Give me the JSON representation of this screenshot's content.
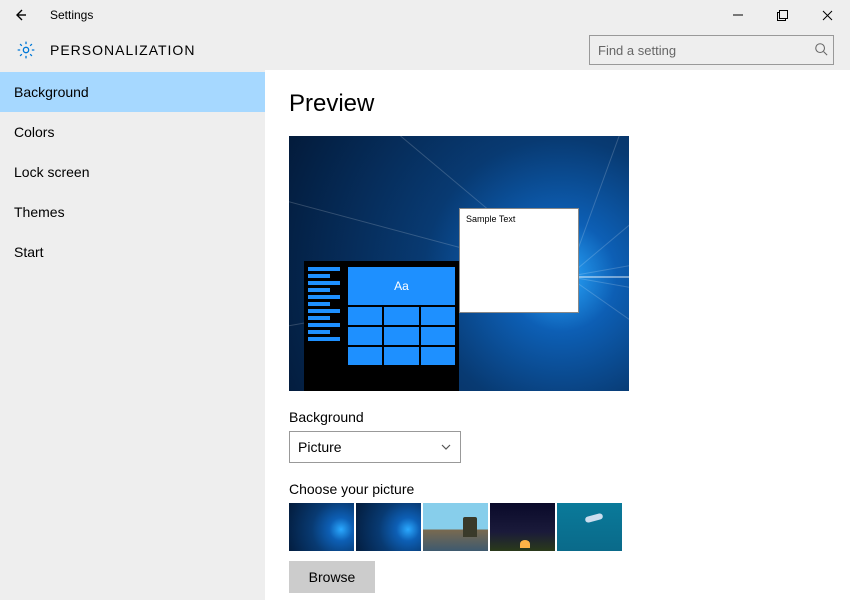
{
  "window": {
    "title": "Settings"
  },
  "header": {
    "section": "PERSONALIZATION",
    "search_placeholder": "Find a setting"
  },
  "sidebar": {
    "items": [
      {
        "label": "Background",
        "active": true
      },
      {
        "label": "Colors"
      },
      {
        "label": "Lock screen"
      },
      {
        "label": "Themes"
      },
      {
        "label": "Start"
      }
    ]
  },
  "main": {
    "preview_heading": "Preview",
    "sample_text": "Sample Text",
    "tile_text": "Aa",
    "background_label": "Background",
    "background_value": "Picture",
    "choose_label": "Choose your picture",
    "browse_label": "Browse"
  }
}
